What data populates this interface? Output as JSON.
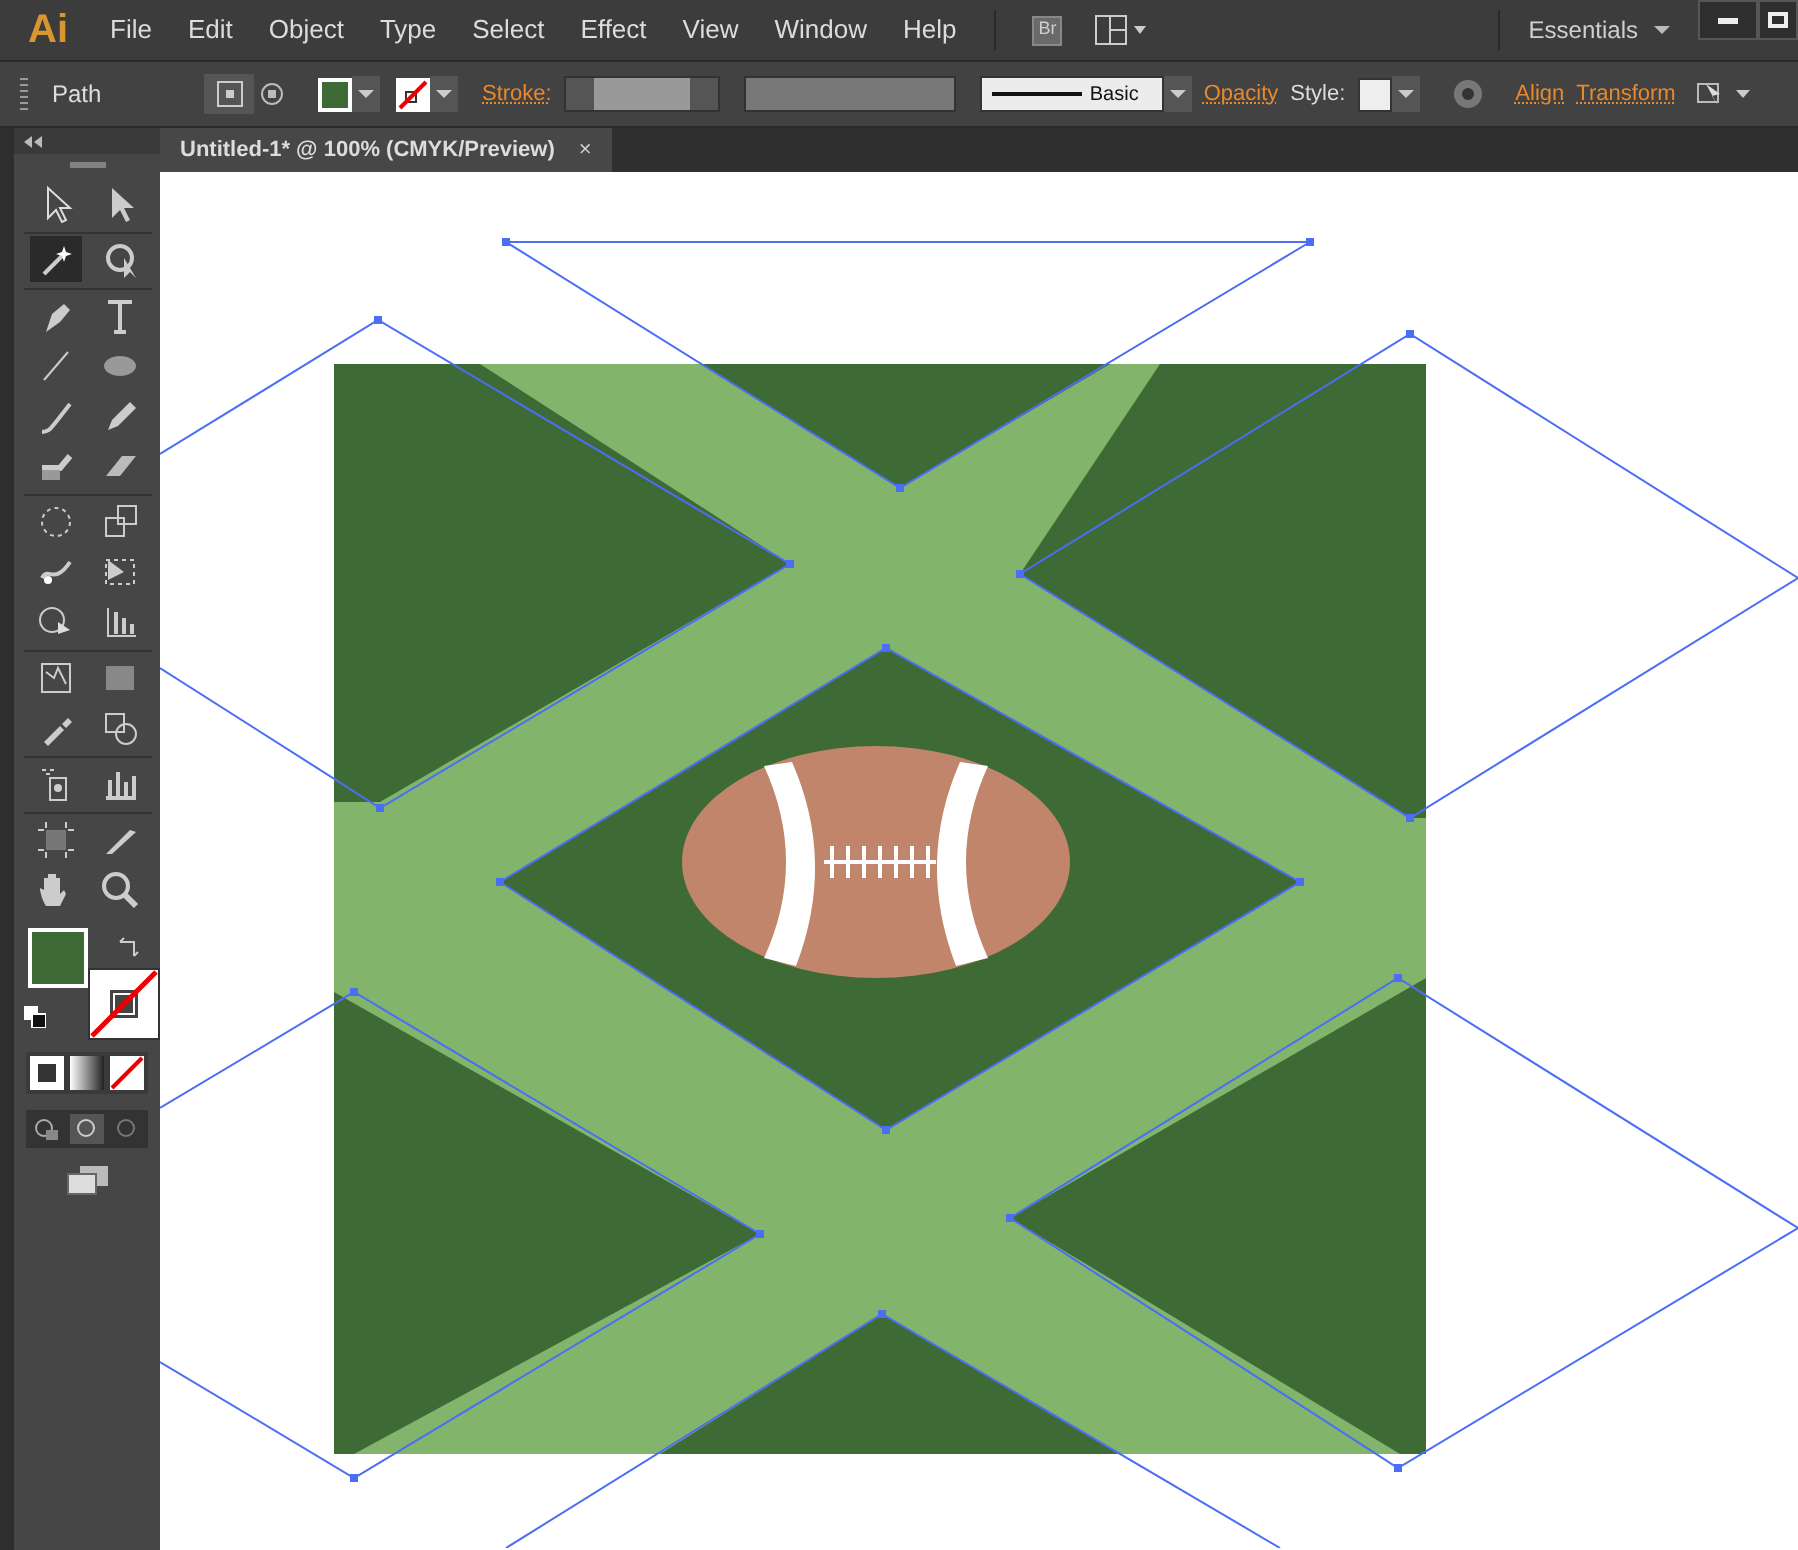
{
  "app": {
    "logo": "Ai",
    "menu": [
      "File",
      "Edit",
      "Object",
      "Type",
      "Select",
      "Effect",
      "View",
      "Window",
      "Help"
    ],
    "bridge": "Br",
    "workspace": "Essentials"
  },
  "control_bar": {
    "selection": "Path",
    "stroke_label": "Stroke:",
    "brush": "Basic",
    "opacity_label": "Opacity",
    "style_label": "Style:",
    "align_label": "Align",
    "transform_label": "Transform"
  },
  "document_tabs": [
    {
      "label": "Untitled-1* @ 100% (CMYK/Preview)",
      "close": "×",
      "selected": true
    }
  ],
  "tools": [
    {
      "selected": false
    },
    {
      "selected": false
    },
    {
      "selected": true
    },
    {
      "selected": false
    },
    {
      "selected": false
    },
    {
      "selected": false
    },
    {
      "selected": false
    },
    {
      "selected": false
    },
    {
      "selected": false
    },
    {
      "selected": false
    },
    {
      "selected": false
    },
    {
      "selected": false
    },
    {
      "selected": false
    },
    {
      "selected": false
    },
    {
      "selected": false
    },
    {
      "selected": false
    },
    {
      "selected": false
    },
    {
      "selected": false
    },
    {
      "selected": false
    },
    {
      "selected": false
    },
    {
      "selected": false
    },
    {
      "selected": false
    },
    {
      "selected": false
    },
    {
      "selected": false
    },
    {
      "selected": false
    },
    {
      "selected": false
    },
    {
      "selected": false
    },
    {
      "selected": false
    }
  ]
}
